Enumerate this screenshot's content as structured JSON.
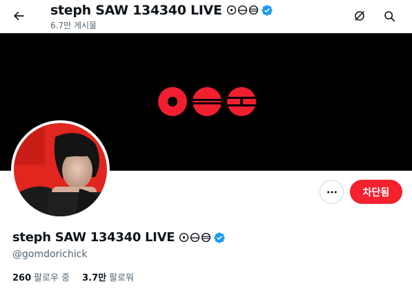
{
  "header": {
    "title": "steph SAW 134340 LIVE",
    "post_count": "6.7만 게시물",
    "back_icon": "arrow-left-icon",
    "grok_icon": "grok-icon",
    "search_icon": "search-icon"
  },
  "profile": {
    "name": "steph SAW 134340 LIVE",
    "symbols": [
      "sun-icon",
      "brick-circle-icon",
      "brick-circle-icon"
    ],
    "verified": true,
    "handle": "@gomdorichick",
    "following_count": "260",
    "following_label": "팔로우 중",
    "followers_count": "3.7만",
    "followers_label": "팔로워",
    "blocked_label": "차단됨"
  },
  "colors": {
    "accent_red": "#f4212e",
    "verified_blue": "#1d9bf0",
    "banner_bg": "#000000",
    "banner_logo_red": "#ef1f2f"
  }
}
